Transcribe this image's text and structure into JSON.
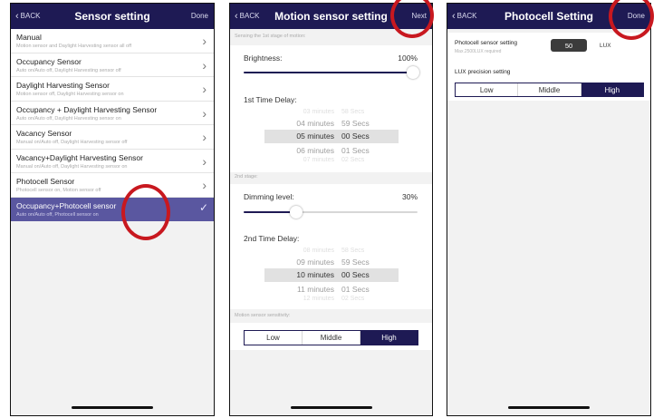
{
  "colors": {
    "nav_bg": "#1e1a54",
    "selected_row": "#5a57a0",
    "annotation_circle": "#c8181f"
  },
  "icons": {
    "back": "chevron-left-icon",
    "row_arrow": "chevron-right-icon",
    "selected": "check-icon"
  },
  "screen1": {
    "back": "BACK",
    "title": "Sensor setting",
    "done": "Done",
    "items": [
      {
        "title": "Manual",
        "subtitle": "Motion sensor and Daylight Harvesting sensor all off"
      },
      {
        "title": "Occupancy Sensor",
        "subtitle": "Auto on/Auto off, Daylight Harvesting sensor off"
      },
      {
        "title": "Daylight Harvesting Sensor",
        "subtitle": "Motion sensor off, Daylight Harvesting sensor on"
      },
      {
        "title": "Occupancy + Daylight Harvesting Sensor",
        "subtitle": "Auto on/Auto off, Daylight Harvesting sensor on"
      },
      {
        "title": "Vacancy Sensor",
        "subtitle": "Manual on/Auto off, Daylight Harvesting sensor off"
      },
      {
        "title": "Vacancy+Daylight Harvesting Sensor",
        "subtitle": "Manual on/Auto off, Daylight Harvesting sensor on"
      },
      {
        "title": "Photocell Sensor",
        "subtitle": "Photocell sensor on, Motion sensor off"
      },
      {
        "title": "Occupancy+Photocell sensor",
        "subtitle": "Auto on/Auto off, Photocell sensor on",
        "selected": true
      }
    ]
  },
  "screen2": {
    "back": "BACK",
    "title": "Motion sensor setting",
    "next": "Next",
    "stage1_label": "Sensing the 1st stage of motion:",
    "brightness_label": "Brightness:",
    "brightness_value": "100%",
    "brightness_level": 1.0,
    "delay1_label": "1st Time Delay:",
    "delay1_rows": [
      {
        "min": "03 minutes",
        "sec": "58 Secs"
      },
      {
        "min": "04 minutes",
        "sec": "59 Secs"
      },
      {
        "min": "05 minutes",
        "sec": "00 Secs"
      },
      {
        "min": "06 minutes",
        "sec": "01 Secs"
      },
      {
        "min": "07 minutes",
        "sec": "02 Secs"
      }
    ],
    "stage2_label": "2nd stage:",
    "dimming_label": "Dimming level:",
    "dimming_value": "30%",
    "dimming_level": 0.3,
    "delay2_label": "2nd Time Delay:",
    "delay2_rows": [
      {
        "min": "08 minutes",
        "sec": "58 Secs"
      },
      {
        "min": "09 minutes",
        "sec": "59 Secs"
      },
      {
        "min": "10 minutes",
        "sec": "00 Secs"
      },
      {
        "min": "11 minutes",
        "sec": "01 Secs"
      },
      {
        "min": "12 minutes",
        "sec": "02 Secs"
      }
    ],
    "sensitivity_label": "Motion sensor sensitivity:",
    "sensitivity_options": [
      "Low",
      "Middle",
      "High"
    ],
    "sensitivity_selected": "High"
  },
  "screen3": {
    "back": "BACK",
    "title": "Photocell Setting",
    "done": "Done",
    "sensor_label": "Photocell sensor setting",
    "sensor_hint": "Max.2500LUX required",
    "lux_value": "50",
    "lux_unit": "LUX",
    "precision_label": "LUX precision setting",
    "precision_options": [
      "Low",
      "Middle",
      "High"
    ],
    "precision_selected": "High"
  }
}
